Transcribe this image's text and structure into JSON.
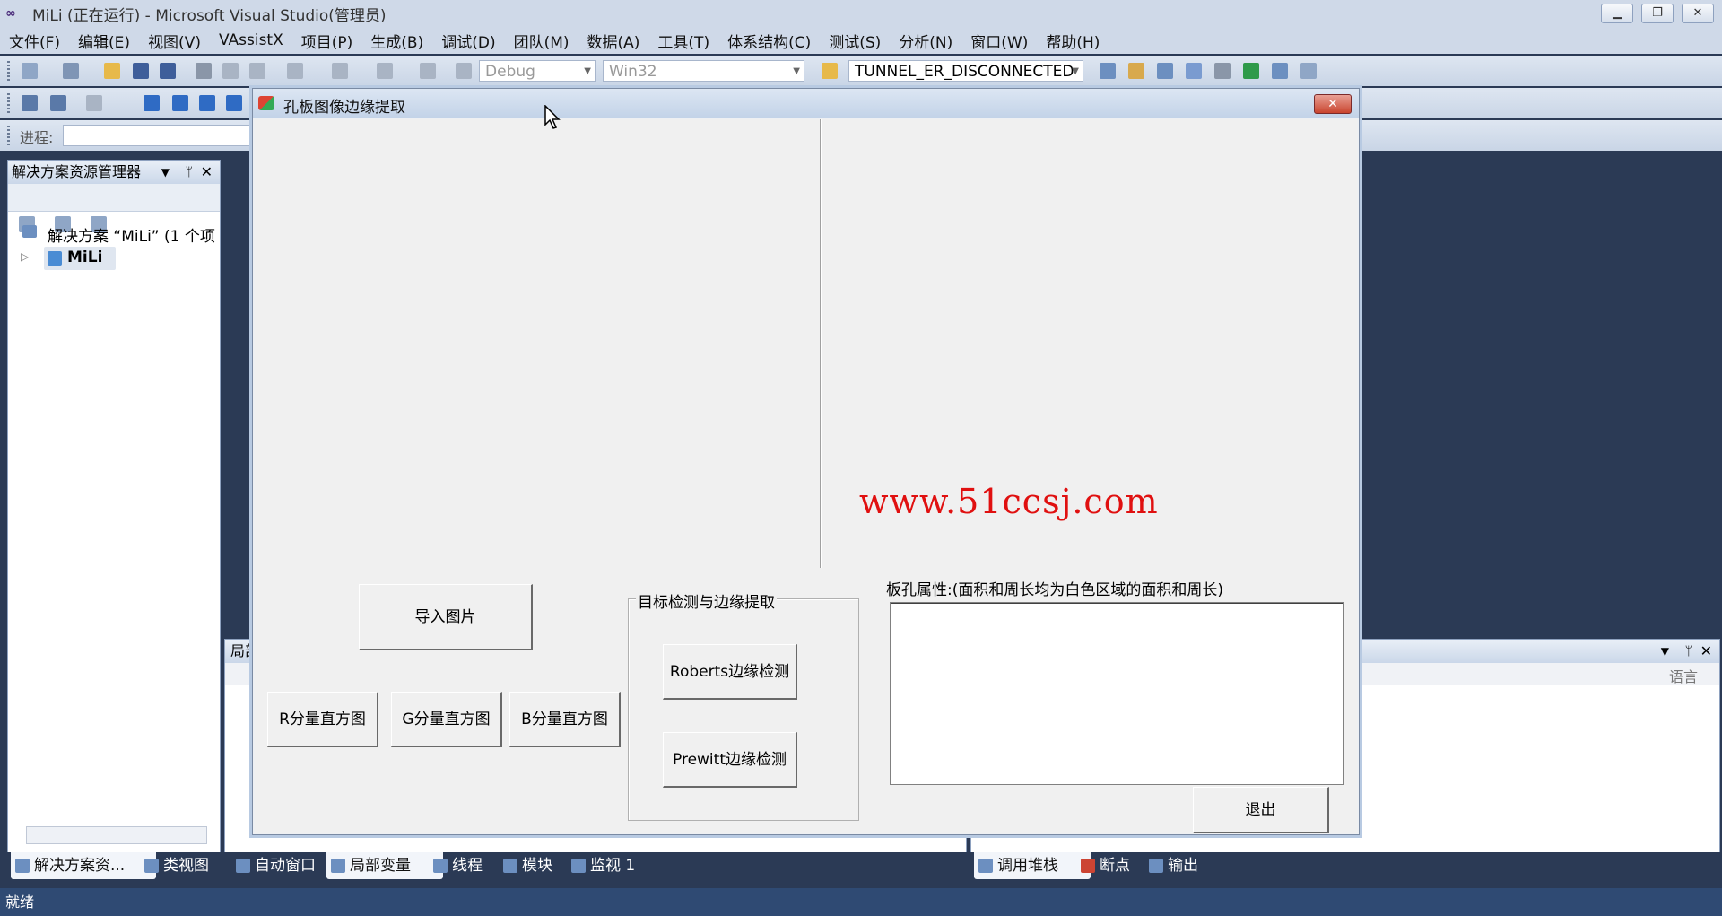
{
  "vs": {
    "title": "MiLi (正在运行) - Microsoft Visual Studio(管理员)",
    "menu": [
      "文件(F)",
      "编辑(E)",
      "视图(V)",
      "VAssistX",
      "项目(P)",
      "生成(B)",
      "调试(D)",
      "团队(M)",
      "数据(A)",
      "工具(T)",
      "体系结构(C)",
      "测试(S)",
      "分析(N)",
      "窗口(W)",
      "帮助(H)"
    ],
    "toolbar": {
      "config": "Debug",
      "platform": "Win32",
      "find_combo": "TUNNEL_ER_DISCONNECTED",
      "progress_label": "进程:"
    },
    "solution_explorer": {
      "title": "解决方案资源管理器",
      "solution_item": "解决方案 “MiLi” (1 个项",
      "project_item": "MiLi"
    },
    "locals_panel": {
      "title": "局部",
      "column": "语言"
    },
    "bottom_tabs_left": [
      "解决方案资...",
      "类视图",
      "自动窗口",
      "局部变量",
      "线程",
      "模块",
      "监视 1"
    ],
    "bottom_tabs_right": [
      "调用堆栈",
      "断点",
      "输出"
    ],
    "status": "就绪"
  },
  "dialog": {
    "title": "孔板图像边缘提取",
    "import_button": "导入图片",
    "r_hist_button": "R分量直方图",
    "g_hist_button": "G分量直方图",
    "b_hist_button": "B分量直方图",
    "group_title": "目标检测与边缘提取",
    "roberts_button": "Roberts边缘检测",
    "prewitt_button": "Prewitt边缘检测",
    "props_label": "板孔属性:(面积和周长均为白色区域的面积和周长)",
    "exit_button": "退出",
    "close_glyph": "✕"
  },
  "watermark": "www.51ccsj.com"
}
